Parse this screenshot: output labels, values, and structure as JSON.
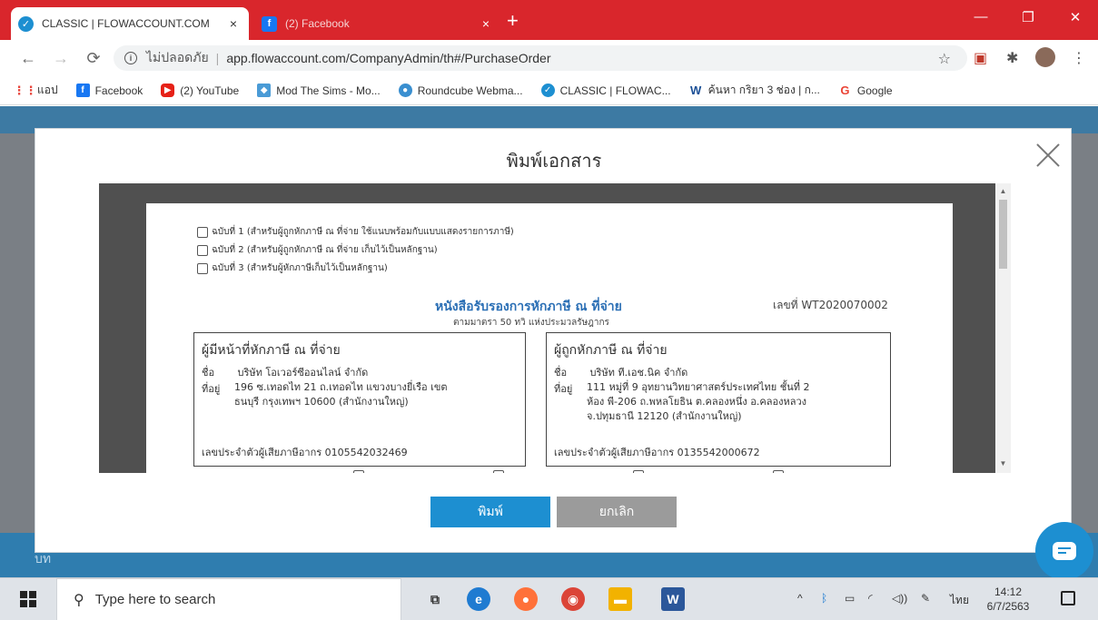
{
  "browser": {
    "tabs": [
      {
        "label": "CLASSIC | FLOWACCOUNT.COM",
        "close": "×",
        "active": true
      },
      {
        "label": "(2) Facebook",
        "close": "×",
        "active": false
      }
    ],
    "new_tab": "+",
    "window_controls": {
      "minimize": "—",
      "maximize": "❐",
      "close": "✕"
    },
    "nav": {
      "back": "←",
      "forward": "→",
      "reload": "⟳"
    },
    "address": {
      "security_label": "ไม่ปลอดภัย",
      "separator": "|",
      "url": "app.flowaccount.com/CompanyAdmin/th#/PurchaseOrder",
      "star": "☆"
    },
    "bookmarks": [
      {
        "label": "แอป",
        "icon": "apps-grid-icon",
        "color": "#e8453c"
      },
      {
        "label": "Facebook",
        "icon": "facebook-icon",
        "color": "#1877f2"
      },
      {
        "label": "(2) YouTube",
        "icon": "youtube-icon",
        "color": "#e62117"
      },
      {
        "label": "Mod The Sims - Mo...",
        "icon": "sims-icon",
        "color": "#4a9bd6"
      },
      {
        "label": "Roundcube Webma...",
        "icon": "roundcube-icon",
        "color": "#3a8fd0"
      },
      {
        "label": "CLASSIC | FLOWAC...",
        "icon": "flowaccount-icon",
        "color": "#1d8fd1"
      },
      {
        "label": "ค้นหา กริยา 3 ช่อง | ก...",
        "icon": "w-icon",
        "color": "#1a4f96"
      },
      {
        "label": "Google",
        "icon": "google-icon",
        "color": "#ea4335"
      }
    ]
  },
  "page": {
    "footer_label": "บท"
  },
  "modal": {
    "title": "พิมพ์เอกสาร",
    "copies": [
      "ฉบับที่ 1 (สำหรับผู้ถูกหักภาษี ณ ที่จ่าย ใช้แนบพร้อมกับแบบแสดงรายการภาษี)",
      "ฉบับที่ 2 (สำหรับผู้ถูกหักภาษี ณ ที่จ่าย เก็บไว้เป็นหลักฐาน)",
      "ฉบับที่ 3 (สำหรับผู้หักภาษีเก็บไว้เป็นหลักฐาน)"
    ],
    "doc_title": "หนังสือรับรองการหักภาษี ณ ที่จ่าย",
    "doc_subtitle": "ตามมาตรา 50 ทวิ แห่งประมวลรัษฎากร",
    "doc_number": "เลขที่ WT2020070002",
    "payer": {
      "title": "ผู้มีหน้าที่หักภาษี ณ ที่จ่าย",
      "name_label": "ชื่อ",
      "name": "บริษัท โอเวอร์ซีออนไลน์ จำกัด",
      "address_label": "ที่อยู่",
      "address_line1": "196 ซ.เทอดไท 21 ถ.เทอดไท แขวงบางยี่เรือ เขต",
      "address_line2": "ธนบุรี กรุงเทพฯ 10600 (สำนักงานใหญ่)",
      "tax_id": "เลขประจำตัวผู้เสียภาษีอากร 0105542032469"
    },
    "payee": {
      "title": "ผู้ถูกหักภาษี ณ ที่จ่าย",
      "name_label": "ชื่อ",
      "name": "บริษัท ที.เอช.นิค จำกัด",
      "address_label": "ที่อยู่",
      "address_line1": "111 หมู่ที่ 9 อุทยานวิทยาศาสตร์ประเทศไทย ชั้นที่ 2",
      "address_line2": "ห้อง พี-206 ถ.พหลโยธิน ต.คลองหนึ่ง อ.คลองหลวง",
      "address_line3": "จ.ปทุมธานี 12120 (สำนักงานใหญ่)",
      "tax_id": "เลขประจำตัวผู้เสียภาษีอากร 0135542000672"
    },
    "print_button": "พิมพ์",
    "cancel_button": "ยกเลิก"
  },
  "taskbar": {
    "search_placeholder": "Type here to search",
    "tray_caret": "^",
    "language": "ไทย",
    "time": "14:12",
    "date": "6/7/2563"
  }
}
